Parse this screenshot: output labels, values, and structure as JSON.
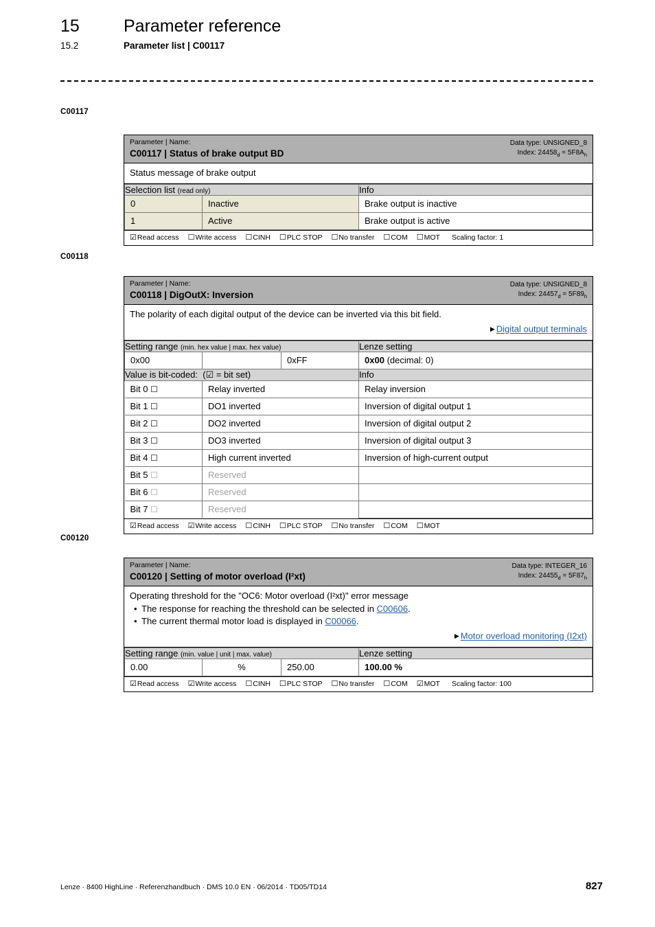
{
  "header": {
    "chapter_number": "15",
    "chapter_title": "Parameter reference",
    "section_number": "15.2",
    "section_title": "Parameter list | C00117"
  },
  "margin_labels": {
    "c117": "C00117",
    "c118": "C00118",
    "c120": "C00120"
  },
  "blocks": {
    "c00117": {
      "title_sub": "Parameter | Name:",
      "title_main": "C00117 | Status of brake output BD",
      "data_type": "Data type: UNSIGNED_8",
      "index_prefix": "Index: 24458",
      "index_sub_d": "d",
      "index_mid": " = 5F8A",
      "index_sub_h": "h",
      "description": "Status message of brake output",
      "selection_header": "Selection list",
      "selection_header_note": "(read only)",
      "info_header": "Info",
      "rows": [
        {
          "value": "0",
          "name": "Inactive",
          "info": "Brake output is inactive"
        },
        {
          "value": "1",
          "name": "Active",
          "info": "Brake output is active"
        }
      ],
      "access": {
        "read": {
          "box": "☑",
          "label": "Read access"
        },
        "write": {
          "box": "☐",
          "label": "Write access"
        },
        "cinh": {
          "box": "☐",
          "label": "CINH"
        },
        "plc_stop": {
          "box": "☐",
          "label": "PLC STOP"
        },
        "no_transfer": {
          "box": "☐",
          "label": "No transfer"
        },
        "com": {
          "box": "☐",
          "label": "COM"
        },
        "mot": {
          "box": "☐",
          "label": "MOT"
        },
        "scaling": "Scaling factor: 1"
      }
    },
    "c00118": {
      "title_sub": "Parameter | Name:",
      "title_main": "C00118 | DigOutX: Inversion",
      "data_type": "Data type: UNSIGNED_8",
      "index_prefix": "Index: 24457",
      "index_sub_d": "d",
      "index_mid": " = 5F89",
      "index_sub_h": "h",
      "description": "The polarity of each digital output of the device can be inverted via this bit field.",
      "see_also": "Digital output terminals",
      "range_header": "Setting range",
      "range_header_note": "(min. hex value | max. hex value)",
      "lenze_header": "Lenze setting",
      "range_min": "0x00",
      "range_unit": "",
      "range_max": "0xFF",
      "lenze_value_bold": "0x00",
      "lenze_value_rest": "(decimal: 0)",
      "bitcoded_header": "Value is bit-coded:",
      "bitcoded_note": "(☑ = bit set)",
      "info_header": "Info",
      "bits": [
        {
          "bit": "Bit 0",
          "box": "☐",
          "name": "Relay inverted",
          "info": "Relay inversion",
          "reserved": false
        },
        {
          "bit": "Bit 1",
          "box": "☐",
          "name": "DO1 inverted",
          "info": "Inversion of digital output 1",
          "reserved": false
        },
        {
          "bit": "Bit 2",
          "box": "☐",
          "name": "DO2 inverted",
          "info": "Inversion of digital output 2",
          "reserved": false
        },
        {
          "bit": "Bit 3",
          "box": "☐",
          "name": "DO3 inverted",
          "info": "Inversion of digital output 3",
          "reserved": false
        },
        {
          "bit": "Bit 4",
          "box": "☐",
          "name": "High current inverted",
          "info": "Inversion of high-current output",
          "reserved": false
        },
        {
          "bit": "Bit 5",
          "box": "☐",
          "name": "Reserved",
          "info": "",
          "reserved": true
        },
        {
          "bit": "Bit 6",
          "box": "☐",
          "name": "Reserved",
          "info": "",
          "reserved": true
        },
        {
          "bit": "Bit 7",
          "box": "☐",
          "name": "Reserved",
          "info": "",
          "reserved": true
        }
      ],
      "access": {
        "read": {
          "box": "☑",
          "label": "Read access"
        },
        "write": {
          "box": "☑",
          "label": "Write access"
        },
        "cinh": {
          "box": "☐",
          "label": "CINH"
        },
        "plc_stop": {
          "box": "☐",
          "label": "PLC STOP"
        },
        "no_transfer": {
          "box": "☐",
          "label": "No transfer"
        },
        "com": {
          "box": "☐",
          "label": "COM"
        },
        "mot": {
          "box": "☐",
          "label": "MOT"
        },
        "scaling": ""
      }
    },
    "c00120": {
      "title_sub": "Parameter | Name:",
      "title_main": "C00120 | Setting of motor overload (I²xt)",
      "data_type": "Data type: INTEGER_16",
      "index_prefix": "Index: 24455",
      "index_sub_d": "d",
      "index_mid": " = 5F87",
      "index_sub_h": "h",
      "description": "Operating threshold for the \"OC6: Motor overload (I²xt)\" error message",
      "bullets": [
        {
          "pre": "The response for reaching the threshold can be selected in ",
          "link": "C00606",
          "post": "."
        },
        {
          "pre": "The current thermal motor load is displayed in ",
          "link": "C00066",
          "post": "."
        }
      ],
      "see_also": "Motor overload monitoring (I2xt)",
      "range_header": "Setting range",
      "range_header_note": "(min. value | unit | max. value)",
      "lenze_header": "Lenze setting",
      "range_min": "0.00",
      "range_unit": "%",
      "range_max": "250.00",
      "lenze_value_bold": "100.00 %",
      "access": {
        "read": {
          "box": "☑",
          "label": "Read access"
        },
        "write": {
          "box": "☑",
          "label": "Write access"
        },
        "cinh": {
          "box": "☐",
          "label": "CINH"
        },
        "plc_stop": {
          "box": "☐",
          "label": "PLC STOP"
        },
        "no_transfer": {
          "box": "☐",
          "label": "No transfer"
        },
        "com": {
          "box": "☐",
          "label": "COM"
        },
        "mot": {
          "box": "☑",
          "label": "MOT"
        },
        "scaling": "Scaling factor: 100"
      }
    }
  },
  "footer": {
    "text": "Lenze · 8400 HighLine · Referenzhandbuch · DMS 10.0 EN · 06/2014 · TD05/TD14",
    "page": "827"
  }
}
